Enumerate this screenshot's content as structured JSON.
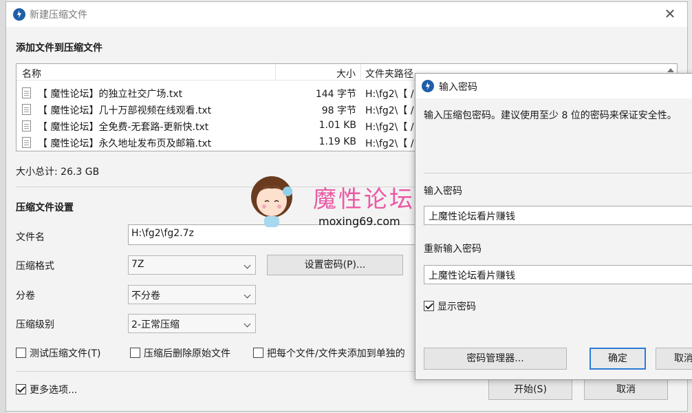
{
  "main_window": {
    "title": "新建压缩文件",
    "close_glyph": "✕",
    "add_files_heading": "添加文件到压缩文件",
    "columns": {
      "name": "名称",
      "size": "大小",
      "folder": "文件夹路径"
    },
    "files": [
      {
        "name": "【 魔性论坛】的独立社交广场.txt",
        "size": "144 字节",
        "path": "H:\\fg2\\【 /"
      },
      {
        "name": "【 魔性论坛】几十万部视频在线观看.txt",
        "size": "98 字节",
        "path": "H:\\fg2\\【 /"
      },
      {
        "name": "【 魔性论坛】全免费-无套路-更新快.txt",
        "size": "1.01 KB",
        "path": "H:\\fg2\\【 /"
      },
      {
        "name": "【 魔性论坛】永久地址发布页及邮箱.txt",
        "size": "1.19 KB",
        "path": "H:\\fg2\\【 /"
      }
    ],
    "total_size": "大小总计: 26.3 GB",
    "settings_heading": "压缩文件设置",
    "filename_label": "文件名",
    "filename_value": "H:\\fg2\\fg2.7z",
    "format_label": "压缩格式",
    "format_value": "7Z",
    "set_password_button": "设置密码(P)...",
    "split_label": "分卷",
    "split_value": "不分卷",
    "level_label": "压缩级别",
    "level_value": "2-正常压缩",
    "test_archive": "测试压缩文件(T)",
    "delete_after": "压缩后删除原始文件",
    "add_each_separately": "把每个文件/文件夹添加到单独的",
    "more_options": "更多选项...",
    "more_options_checked": true,
    "start_button": "开始(S)",
    "cancel_button": "取消"
  },
  "password_dialog": {
    "title": "输入密码",
    "description": "输入压缩包密码。建议使用至少 8 位的密码来保证安全性。",
    "enter_label": "输入密码",
    "enter_value": "上魔性论坛看片赚钱",
    "reenter_label": "重新输入密码",
    "reenter_value": "上魔性论坛看片赚钱",
    "show_password": "显示密码",
    "show_password_checked": true,
    "manager_button": "密码管理器...",
    "ok_button": "确定",
    "cancel_button": "取消"
  },
  "watermark": {
    "text": "魔性论坛",
    "url": "moxing69.com"
  },
  "colors": {
    "app_icon": "#1f5ea8",
    "watermark_pink": "#ea5aa5",
    "focus_border": "#2a7ad6"
  }
}
